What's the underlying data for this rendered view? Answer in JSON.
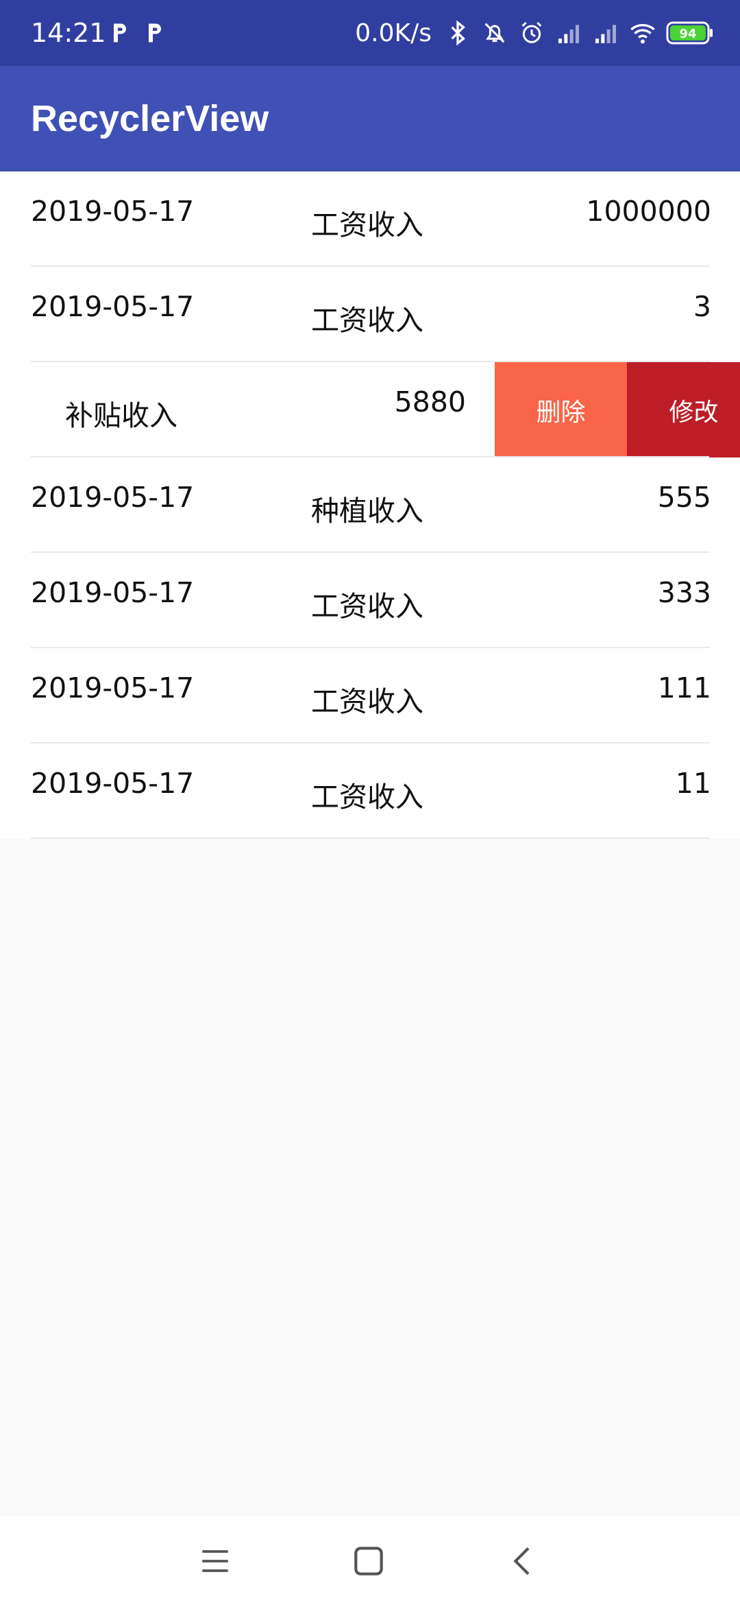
{
  "status_bar": {
    "time": "14:21",
    "net_speed": "0.0K/s",
    "battery_level": "94",
    "icons": [
      "parking-p-icon",
      "parking-p-icon",
      "bluetooth-icon",
      "mute-icon",
      "alarm-icon",
      "signal-icon",
      "signal-icon",
      "wifi-icon",
      "battery-icon"
    ]
  },
  "app_bar": {
    "title": "RecyclerView"
  },
  "records": [
    {
      "date": "2019-05-17",
      "category": "工资收入",
      "amount": "1000000"
    },
    {
      "date": "2019-05-17",
      "category": "工资收入",
      "amount": "3"
    },
    {
      "date": "",
      "category": "补贴收入",
      "amount": "5880",
      "swiped": true
    },
    {
      "date": "2019-05-17",
      "category": "种植收入",
      "amount": "555"
    },
    {
      "date": "2019-05-17",
      "category": "工资收入",
      "amount": "333"
    },
    {
      "date": "2019-05-17",
      "category": "工资收入",
      "amount": "111"
    },
    {
      "date": "2019-05-17",
      "category": "工资收入",
      "amount": "11"
    }
  ],
  "swipe_actions": {
    "delete_label": "删除",
    "edit_label": "修改"
  },
  "colors": {
    "status_bar": "#303f9f",
    "app_bar": "#3f51b5",
    "delete": "#fa6448",
    "edit": "#bd1e27"
  },
  "nav_bar": {
    "icons": [
      "menu-icon",
      "home-icon",
      "back-icon"
    ]
  }
}
